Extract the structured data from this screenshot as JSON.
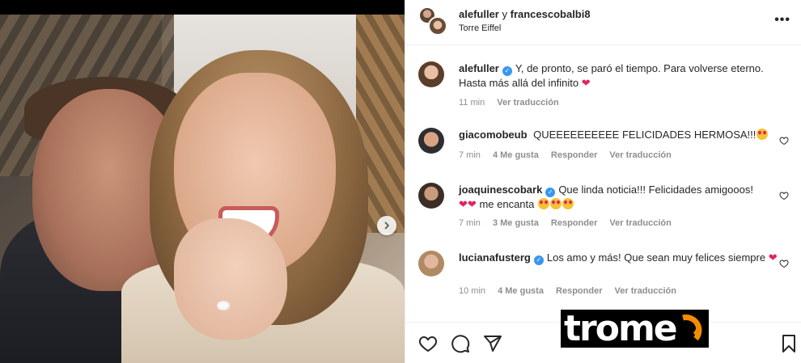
{
  "post": {
    "users": "alefuller",
    "and_word": "y",
    "coauthor": "francescobalbi8",
    "location": "Torre Eiffel",
    "more": "•••"
  },
  "caption": {
    "username": "alefuller",
    "text": "Y, de pronto, se paró el tiempo. Para volverse eterno. Hasta más allá del infinito",
    "time": "11 min",
    "translate": "Ver traducción"
  },
  "comments": [
    {
      "username": "giacomobeub",
      "verified": false,
      "text": "QUEEEEEEEEEE FELICIDADES HERMOSA!!!",
      "time": "7 min",
      "likes": "4 Me gusta",
      "reply": "Responder",
      "translate": "Ver traducción"
    },
    {
      "username": "joaquinescobark",
      "verified": true,
      "text": "Que linda noticia!!! Felicidades amigooos!",
      "text2": "me encanta",
      "time": "7 min",
      "likes": "3 Me gusta",
      "reply": "Responder",
      "translate": "Ver traducción"
    },
    {
      "username": "lucianafusterg",
      "verified": true,
      "text": "Los amo y más! Que sean muy felices siempre",
      "time": "10 min",
      "likes": "4 Me gusta",
      "reply": "Responder",
      "translate": "Ver traducción"
    }
  ],
  "watermark": {
    "text": "trome"
  },
  "colors": {
    "verified": "#3897f0",
    "heart": "#e0245e",
    "muted": "#8e8e8e",
    "watermark_accent": "#f28c00"
  }
}
